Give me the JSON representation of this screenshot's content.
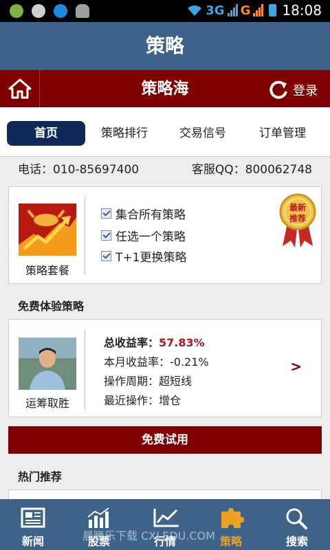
{
  "status_bar": {
    "network1": "3G",
    "network2": "G",
    "time": "18:08"
  },
  "title": "策略",
  "header": {
    "brand": "策略海",
    "login_label": "登录"
  },
  "tabs": [
    {
      "label": "首页",
      "active": true
    },
    {
      "label": "策略排行",
      "active": false
    },
    {
      "label": "交易信号",
      "active": false
    },
    {
      "label": "订单管理",
      "active": false
    }
  ],
  "contact": {
    "phone": "电话：010-85697400",
    "qq": "客服QQ：800062748"
  },
  "package": {
    "caption": "策略套餐",
    "badge_line1": "最新",
    "badge_line2": "推荐",
    "options": [
      "集合所有策略",
      "任选一个策略",
      "T+1更换策略"
    ]
  },
  "free_trial": {
    "section_title": "免费体验策略",
    "strategy_name": "运筹取胜",
    "total_return_label": "总收益率：",
    "total_return_value": "57.83%",
    "month_return": "本月收益率：-0.21%",
    "period": "操作周期：超短线",
    "recent_action": "最近操作：增仓",
    "arrow": ">",
    "cta_label": "免费试用"
  },
  "hot": {
    "section_title": "热门推荐"
  },
  "bottom_nav": [
    {
      "label": "新闻",
      "icon": "newspaper-icon"
    },
    {
      "label": "股票",
      "icon": "bar-chart-icon"
    },
    {
      "label": "行情",
      "icon": "line-chart-icon"
    },
    {
      "label": "策略",
      "icon": "puzzle-icon",
      "active": true
    },
    {
      "label": "搜索",
      "icon": "search-icon"
    }
  ],
  "watermark": "晨曦乐下载 CXLEDU.COM",
  "colors": {
    "title_bg": "#3d6389",
    "accent_maroon": "#7e0000",
    "active_tab": "#0f2a57",
    "nav_active": "#f0a020"
  }
}
